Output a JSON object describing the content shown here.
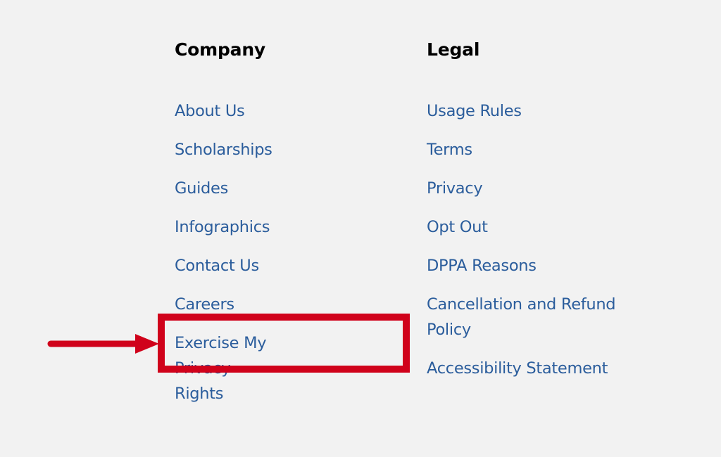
{
  "footer": {
    "company": {
      "heading": "Company",
      "links": [
        {
          "label": "About Us"
        },
        {
          "label": "Scholarships"
        },
        {
          "label": "Guides"
        },
        {
          "label": "Infographics"
        },
        {
          "label": "Contact Us"
        },
        {
          "label": "Careers"
        },
        {
          "label": "Exercise My Privacy Rights"
        }
      ]
    },
    "legal": {
      "heading": "Legal",
      "links": [
        {
          "label": "Usage Rules"
        },
        {
          "label": "Terms"
        },
        {
          "label": "Privacy"
        },
        {
          "label": "Opt Out"
        },
        {
          "label": "DPPA Reasons"
        },
        {
          "label": "Cancellation and Refund Policy"
        },
        {
          "label": "Accessibility Statement"
        }
      ]
    }
  },
  "annotation": {
    "highlight_target": "Exercise My Privacy Rights",
    "color": "#d0021b"
  },
  "colors": {
    "background": "#f2f2f2",
    "link": "#2b5d9c",
    "heading": "#000000"
  }
}
